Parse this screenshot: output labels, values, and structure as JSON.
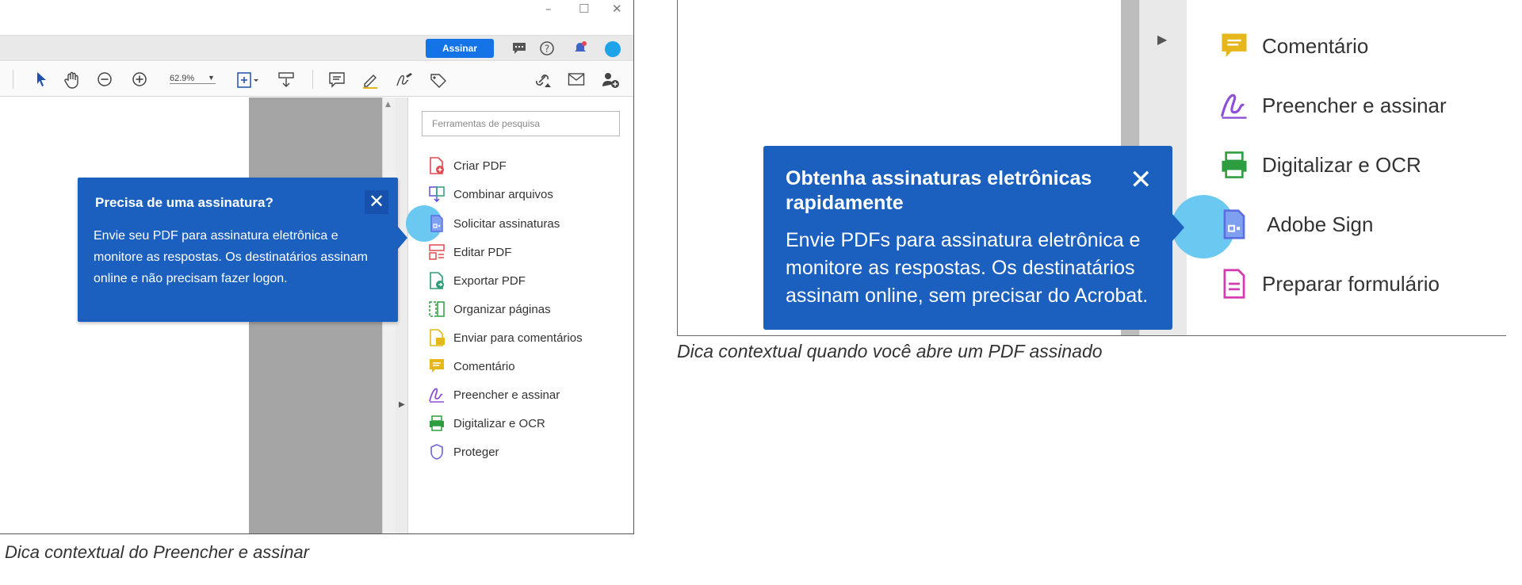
{
  "left_screenshot": {
    "window_controls": {
      "minimize": "–",
      "maximize": "☐",
      "close": "✕"
    },
    "header": {
      "sign_button": "Assinar"
    },
    "toolbar": {
      "zoom_value": "62.9%"
    },
    "tools_panel": {
      "search_placeholder": "Ferramentas de pesquisa",
      "items": [
        {
          "label": "Criar PDF",
          "icon": "create-pdf-icon",
          "color": "#e34850"
        },
        {
          "label": "Combinar arquivos",
          "icon": "combine-files-icon",
          "color": "#5a4dd6"
        },
        {
          "label": "Solicitar assinaturas",
          "icon": "request-signatures-icon",
          "color": "#5b6ee1"
        },
        {
          "label": "Editar PDF",
          "icon": "edit-pdf-icon",
          "color": "#e34850"
        },
        {
          "label": "Exportar PDF",
          "icon": "export-pdf-icon",
          "color": "#2d9d78"
        },
        {
          "label": "Organizar páginas",
          "icon": "organize-pages-icon",
          "color": "#2d9d3f"
        },
        {
          "label": "Enviar para comentários",
          "icon": "send-for-comments-icon",
          "color": "#e6b71a"
        },
        {
          "label": "Comentário",
          "icon": "comment-icon",
          "color": "#e6b71a"
        },
        {
          "label": "Preencher e assinar",
          "icon": "fill-sign-icon",
          "color": "#8c4fd6"
        },
        {
          "label": "Digitalizar e OCR",
          "icon": "scan-ocr-icon",
          "color": "#2d9d3f"
        },
        {
          "label": "Proteger",
          "icon": "protect-icon",
          "color": "#6b63d9"
        }
      ]
    },
    "tooltip": {
      "title": "Precisa de uma assinatura?",
      "close": "✕",
      "body": "Envie seu PDF para assinatura eletrônica e monitore as respostas. Os destinatários assinam online e não precisam fazer logon."
    },
    "caption": "Dica contextual do Preencher e assinar"
  },
  "right_screenshot": {
    "tools_panel": {
      "items": [
        {
          "label": "Comentário",
          "icon": "comment-icon",
          "color": "#e6b71a"
        },
        {
          "label": "Preencher e assinar",
          "icon": "fill-sign-icon",
          "color": "#8c4fd6"
        },
        {
          "label": "Digitalizar e OCR",
          "icon": "scan-ocr-icon",
          "color": "#2d9d3f"
        },
        {
          "label": "Adobe Sign",
          "icon": "adobe-sign-icon",
          "color": "#5b6ee1"
        },
        {
          "label": "Preparar formulário",
          "icon": "prepare-form-icon",
          "color": "#d63ab0"
        }
      ]
    },
    "tooltip": {
      "title": "Obtenha assinaturas eletrônicas rapidamente",
      "close": "✕",
      "body": "Envie PDFs para assinatura eletrônica e monitore as respostas. Os destinatários assinam online, sem precisar do Acrobat."
    },
    "caption": "Dica contextual quando você abre um PDF assinado"
  },
  "colors": {
    "accent": "#1473e6",
    "tooltip_bg": "#1b5fbf",
    "halo": "#6bc8f0"
  }
}
